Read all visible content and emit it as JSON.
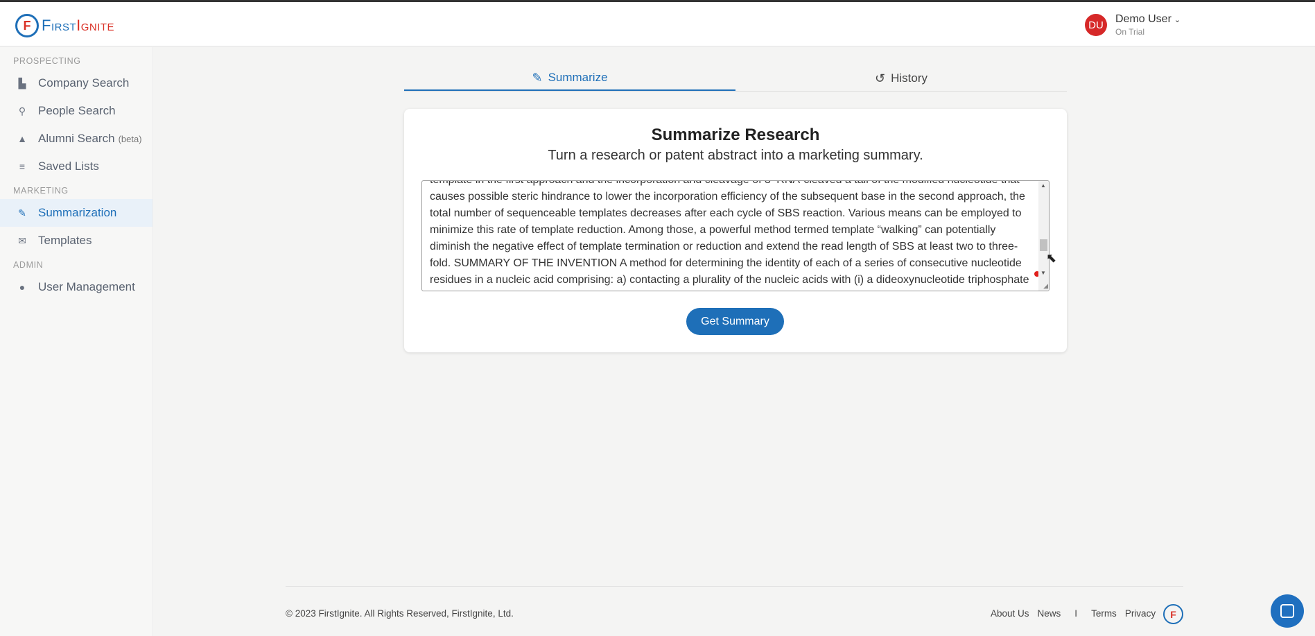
{
  "header": {
    "logo_text_a": "First",
    "logo_text_b": "Ignite",
    "logo_mark": "F",
    "user_initials": "DU",
    "user_name": "Demo User",
    "user_status": "On Trial"
  },
  "sidebar": {
    "sections": [
      {
        "label": "PROSPECTING"
      },
      {
        "label": "MARKETING"
      },
      {
        "label": "ADMIN"
      }
    ],
    "items": [
      {
        "label": "Company Search",
        "icon": "building-search-icon"
      },
      {
        "label": "People Search",
        "icon": "person-search-icon"
      },
      {
        "label": "Alumni Search",
        "badge": "(beta)",
        "icon": "graduation-cap-icon"
      },
      {
        "label": "Saved Lists",
        "icon": "list-check-icon"
      },
      {
        "label": "Summarization",
        "icon": "document-edit-icon",
        "active": true
      },
      {
        "label": "Templates",
        "icon": "envelope-icon"
      },
      {
        "label": "User Management",
        "icon": "users-icon"
      }
    ]
  },
  "tabs": [
    {
      "label": "Summarize",
      "icon": "document-edit-icon",
      "active": true
    },
    {
      "label": "History",
      "icon": "history-icon"
    }
  ],
  "card": {
    "title": "Summarize Research",
    "subtitle": "Turn a research or patent abstract into a marketing summary.",
    "textarea_value": "template in the first approach and the incorporation and cleavage of 3'-RNA-cleaved a tail of the modified nucleotide that causes possible steric hindrance to lower the incorporation efficiency of the subsequent base in the second approach, the total number of sequenceable templates decreases after each cycle of SBS reaction. Various means can be employed to minimize this rate of template reduction. Among those, a powerful method termed template “walking” can potentially diminish the negative effect of template termination or reduction and extend the read length of SBS at least two to three-fold. SUMMARY OF THE INVENTION A method for determining the identity of each of a series of consecutive nucleotide residues in a nucleic acid comprising: a) contacting a plurality of the nucleic acids with (i) a dideoxynucleotide triphosphate (ddNTP) analogue having a cleavable fluorescent",
    "button_label": "Get Summary"
  },
  "footer": {
    "copyright": "© 2023 FirstIgnite. All Rights Reserved, FirstIgnite, Ltd.",
    "links": [
      "About Us",
      "News",
      "I",
      "Terms",
      "Privacy"
    ]
  },
  "colors": {
    "accent": "#1e6fb8",
    "brand_red": "#d93025",
    "avatar": "#d62828"
  }
}
